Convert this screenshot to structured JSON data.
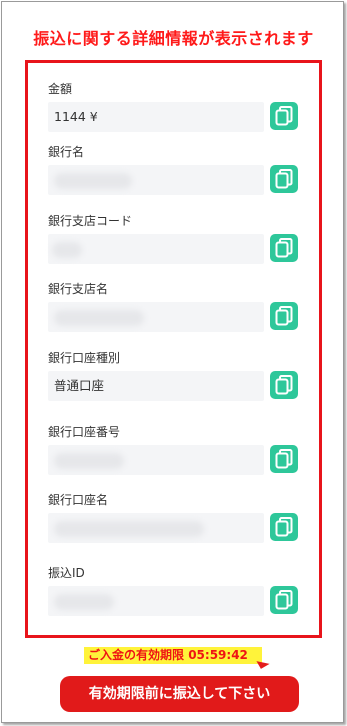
{
  "header": {
    "title": "振込に関する詳細情報が表示されます"
  },
  "fields": [
    {
      "label": "金額",
      "value": "1144 ¥"
    },
    {
      "label": "銀行名",
      "value": ""
    },
    {
      "label": "銀行支店コード",
      "value": ""
    },
    {
      "label": "銀行支店名",
      "value": ""
    },
    {
      "label": "銀行口座種別",
      "value": "普通口座"
    },
    {
      "label": "銀行口座番号",
      "value": ""
    },
    {
      "label": "銀行口座名",
      "value": ""
    },
    {
      "label": "振込ID",
      "value": ""
    }
  ],
  "footer": {
    "expiry_label": "ご入金の有効期限",
    "expiry_time": "05:59:42",
    "cta_label": "有効期限前に振込して下さい"
  },
  "colors": {
    "accent_red": "#e8141b",
    "copy_green": "#2ec79a",
    "highlight_yellow": "#fff33a"
  },
  "icons": {
    "copy": "copy-icon"
  }
}
